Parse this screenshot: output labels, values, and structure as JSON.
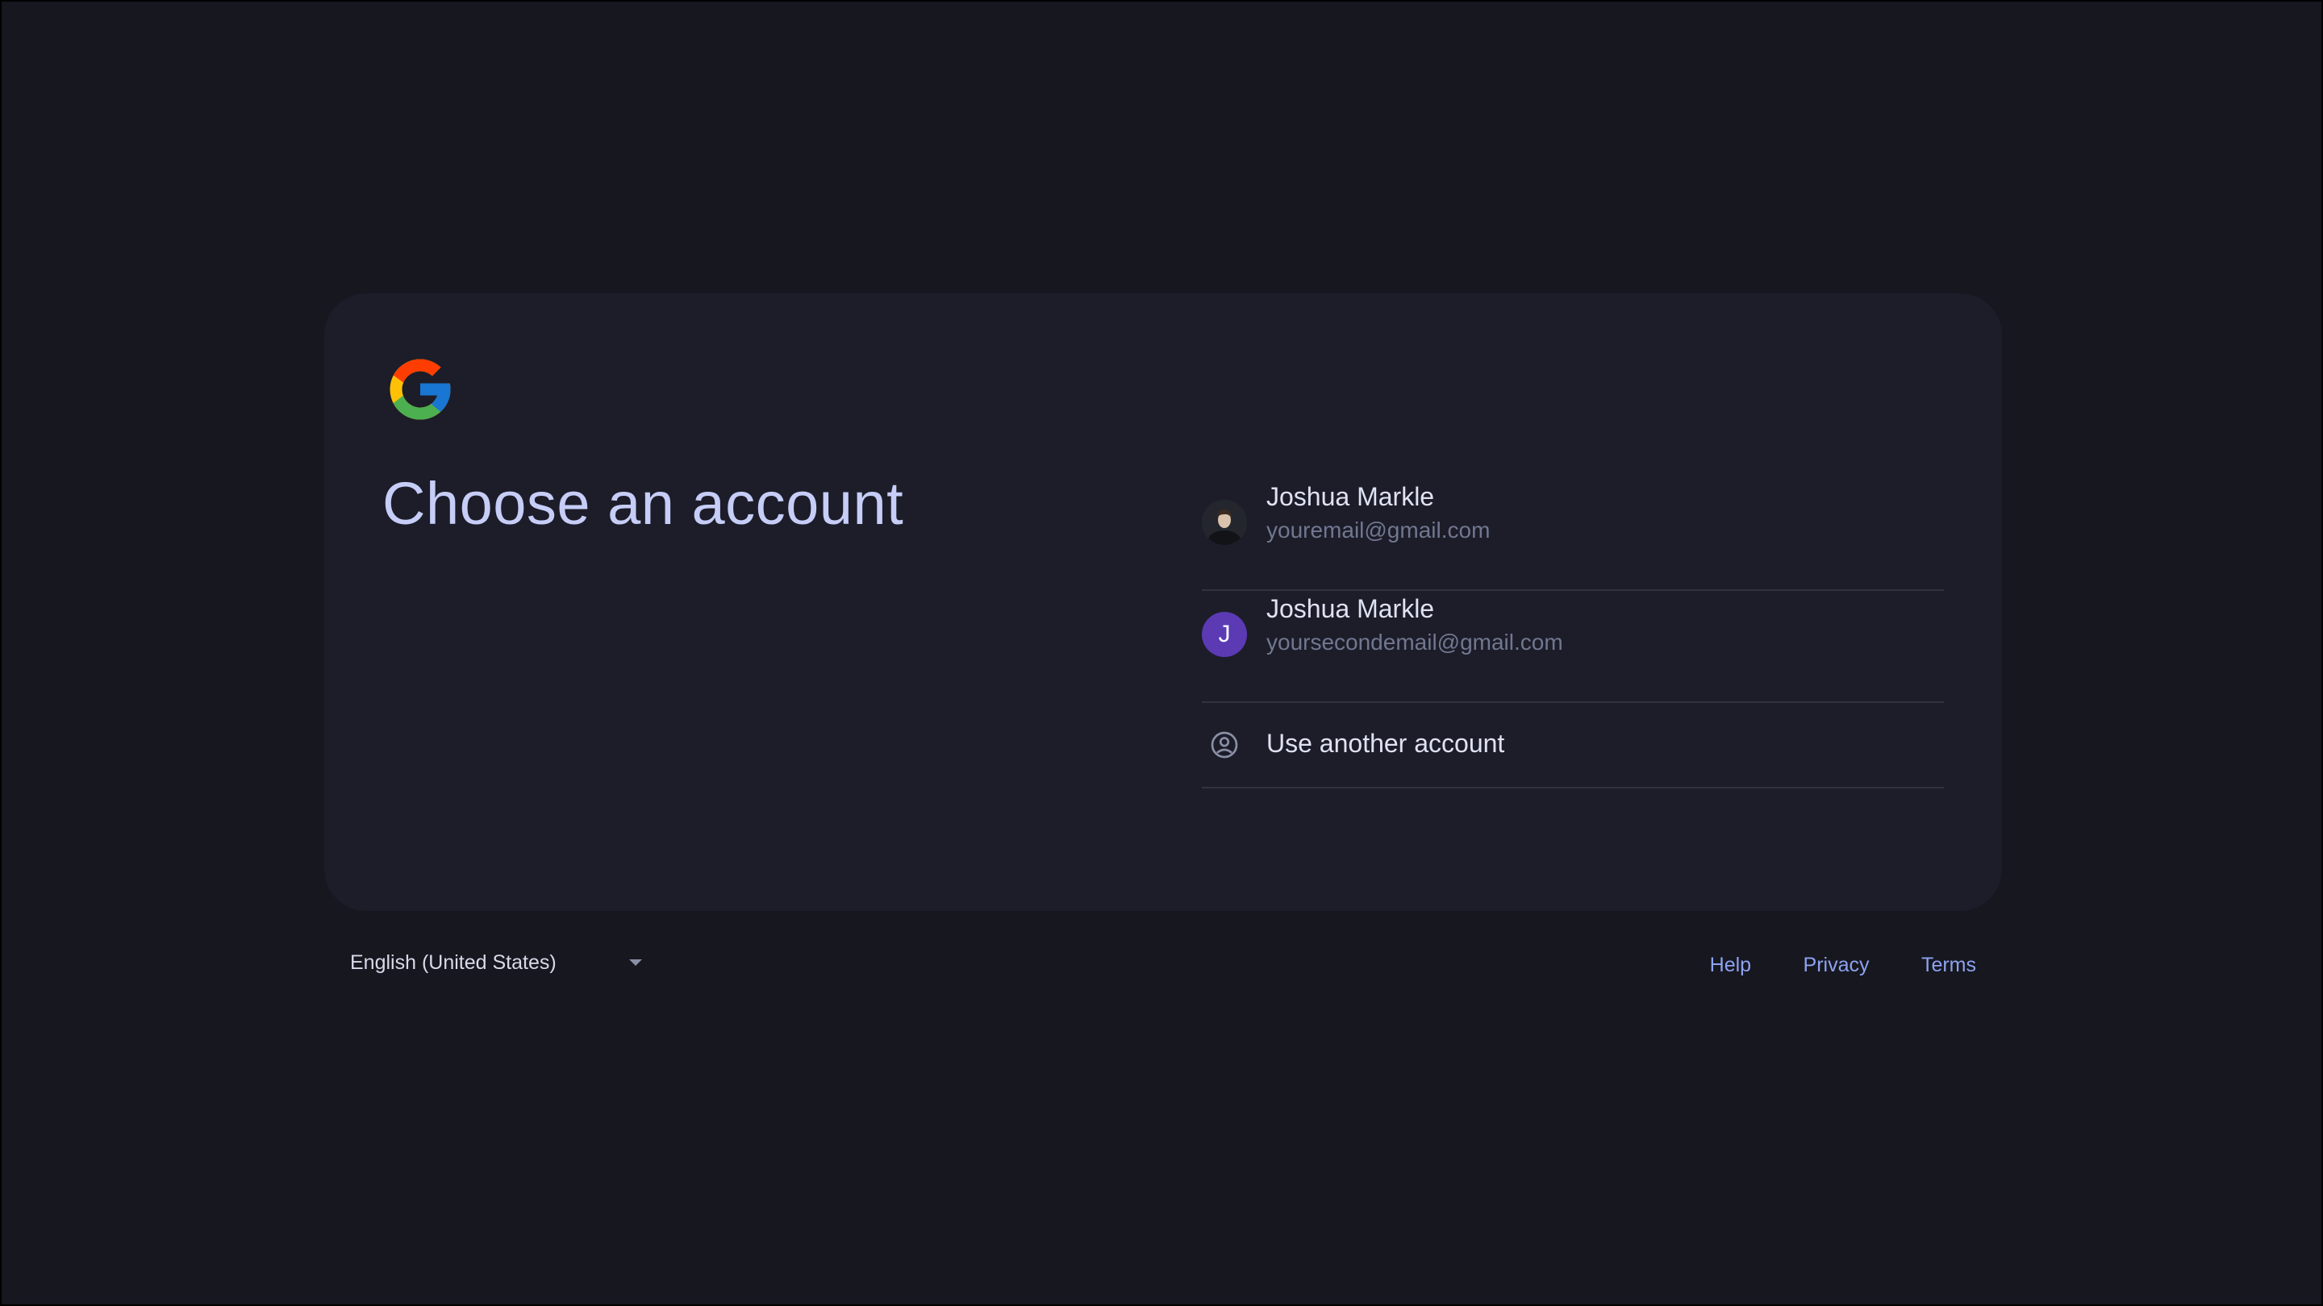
{
  "page": {
    "title": "Choose an account"
  },
  "accounts": [
    {
      "name": "Joshua Markle",
      "email": "youremail@gmail.com",
      "avatar": "photo"
    },
    {
      "name": "Joshua Markle",
      "email": "yoursecondemail@gmail.com",
      "avatar_letter": "J",
      "avatar_color": "#5b3ab4"
    }
  ],
  "other_account": {
    "label": "Use another account",
    "icon": "account-circle-icon"
  },
  "footer": {
    "language": "English (United States)",
    "links": {
      "help": "Help",
      "privacy": "Privacy",
      "terms": "Terms"
    }
  },
  "colors": {
    "background": "#16171f",
    "card": "#1c1d29",
    "title": "#c6cdf7",
    "link": "#8ea2f0"
  }
}
